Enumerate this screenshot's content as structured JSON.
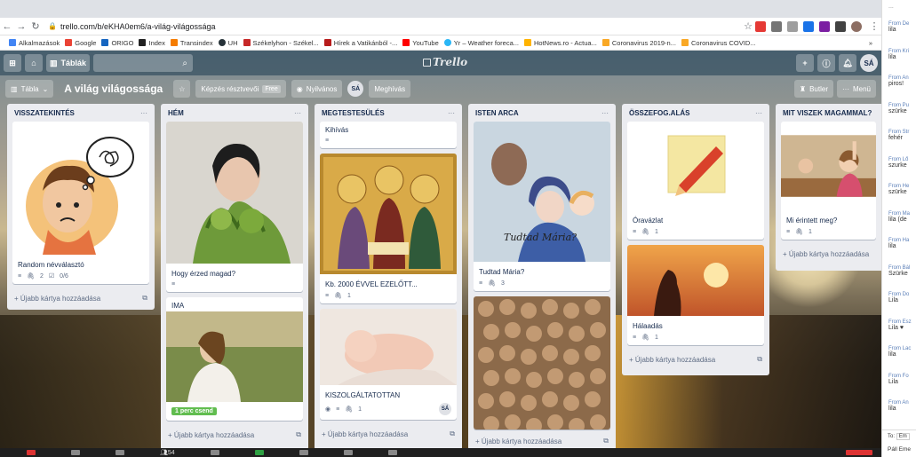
{
  "browser": {
    "url": "trello.com/b/eKHA0em6/a-világ-világossága",
    "bookmarks": [
      "Alkalmazások",
      "Google",
      "ORIGO",
      "Index",
      "Transindex",
      "UH",
      "Székelyhon - Székel...",
      "Hírek a Vatikánból -...",
      "YouTube",
      "Yr – Weather foreca...",
      "HotNews.ro - Actua...",
      "Coronavirus 2019-n...",
      "Coronavirus COVID..."
    ],
    "overflow": "»"
  },
  "trello": {
    "boards_button": "Táblák",
    "logo": "Trello",
    "user_initials": "SÁ",
    "board_view": "Tábla",
    "board_title": "A világ világossága",
    "team_label": "Képzés résztvevői",
    "team_tag": "Free",
    "visibility": "Nyilvános",
    "invite": "Meghívás",
    "butler": "Butler",
    "menu": "Menü",
    "add_card": "+ Újabb kártya hozzáadása"
  },
  "lists": [
    {
      "title": "VISSZATEKINTÉS",
      "cards": [
        {
          "title": "Random névválasztó",
          "attachments": "2",
          "checklist": "0/6"
        }
      ]
    },
    {
      "title": "HÉM",
      "cards": [
        {
          "title": "Hogy érzed magad?"
        },
        {
          "title": "IMA",
          "label": "1 perc csend"
        }
      ]
    },
    {
      "title": "MEGTESTESÜLÉS",
      "cards": [
        {
          "title": "Kihívás"
        },
        {
          "title": "Kb. 2000 ÉVVEL EZELŐTT...",
          "attachments": "1"
        },
        {
          "title": "KISZOLGÁLTATOTTAN",
          "attachments": "1",
          "member": "SÁ"
        }
      ]
    },
    {
      "title": "ISTEN ARCA",
      "cards": [
        {
          "title": "Tudtad Mária?",
          "attachments": "3",
          "overlay": "Tudtad Mária?"
        }
      ]
    },
    {
      "title": "ÖSSZEFOG.ALÁS",
      "cards": [
        {
          "title": "Óravázlat",
          "attachments": "1"
        },
        {
          "title": "Hálaadás",
          "attachments": "1"
        }
      ]
    },
    {
      "title": "MIT VISZEK MAGAMMAL?",
      "cards": [
        {
          "title": "Mi érintett meg?",
          "attachments": "1"
        }
      ]
    }
  ],
  "chat": {
    "top_cut": "...",
    "messages": [
      {
        "from": "From De",
        "text": "lila"
      },
      {
        "from": "From Kri",
        "text": "lila"
      },
      {
        "from": "From An",
        "text": "piros!"
      },
      {
        "from": "From Pu",
        "text": "szürke"
      },
      {
        "from": "From Str",
        "text": "fehér"
      },
      {
        "from": "From Lő",
        "text": "szurke"
      },
      {
        "from": "From He",
        "text": "szürke"
      },
      {
        "from": "From Ma",
        "text": "lila (de"
      },
      {
        "from": "From Ha",
        "text": "lila"
      },
      {
        "from": "From Bál",
        "text": "Szürke"
      },
      {
        "from": "From Do",
        "text": "Lila"
      },
      {
        "from": "From Esz",
        "text": "Lila ♥"
      },
      {
        "from": "From Lac",
        "text": "lila"
      },
      {
        "from": "From Fo",
        "text": "Lila"
      },
      {
        "from": "From An",
        "text": "lila"
      }
    ],
    "to_label": "To:",
    "to_value": "Em",
    "footer": "Páll Eme"
  },
  "taskbar": {
    "participants": "54"
  }
}
